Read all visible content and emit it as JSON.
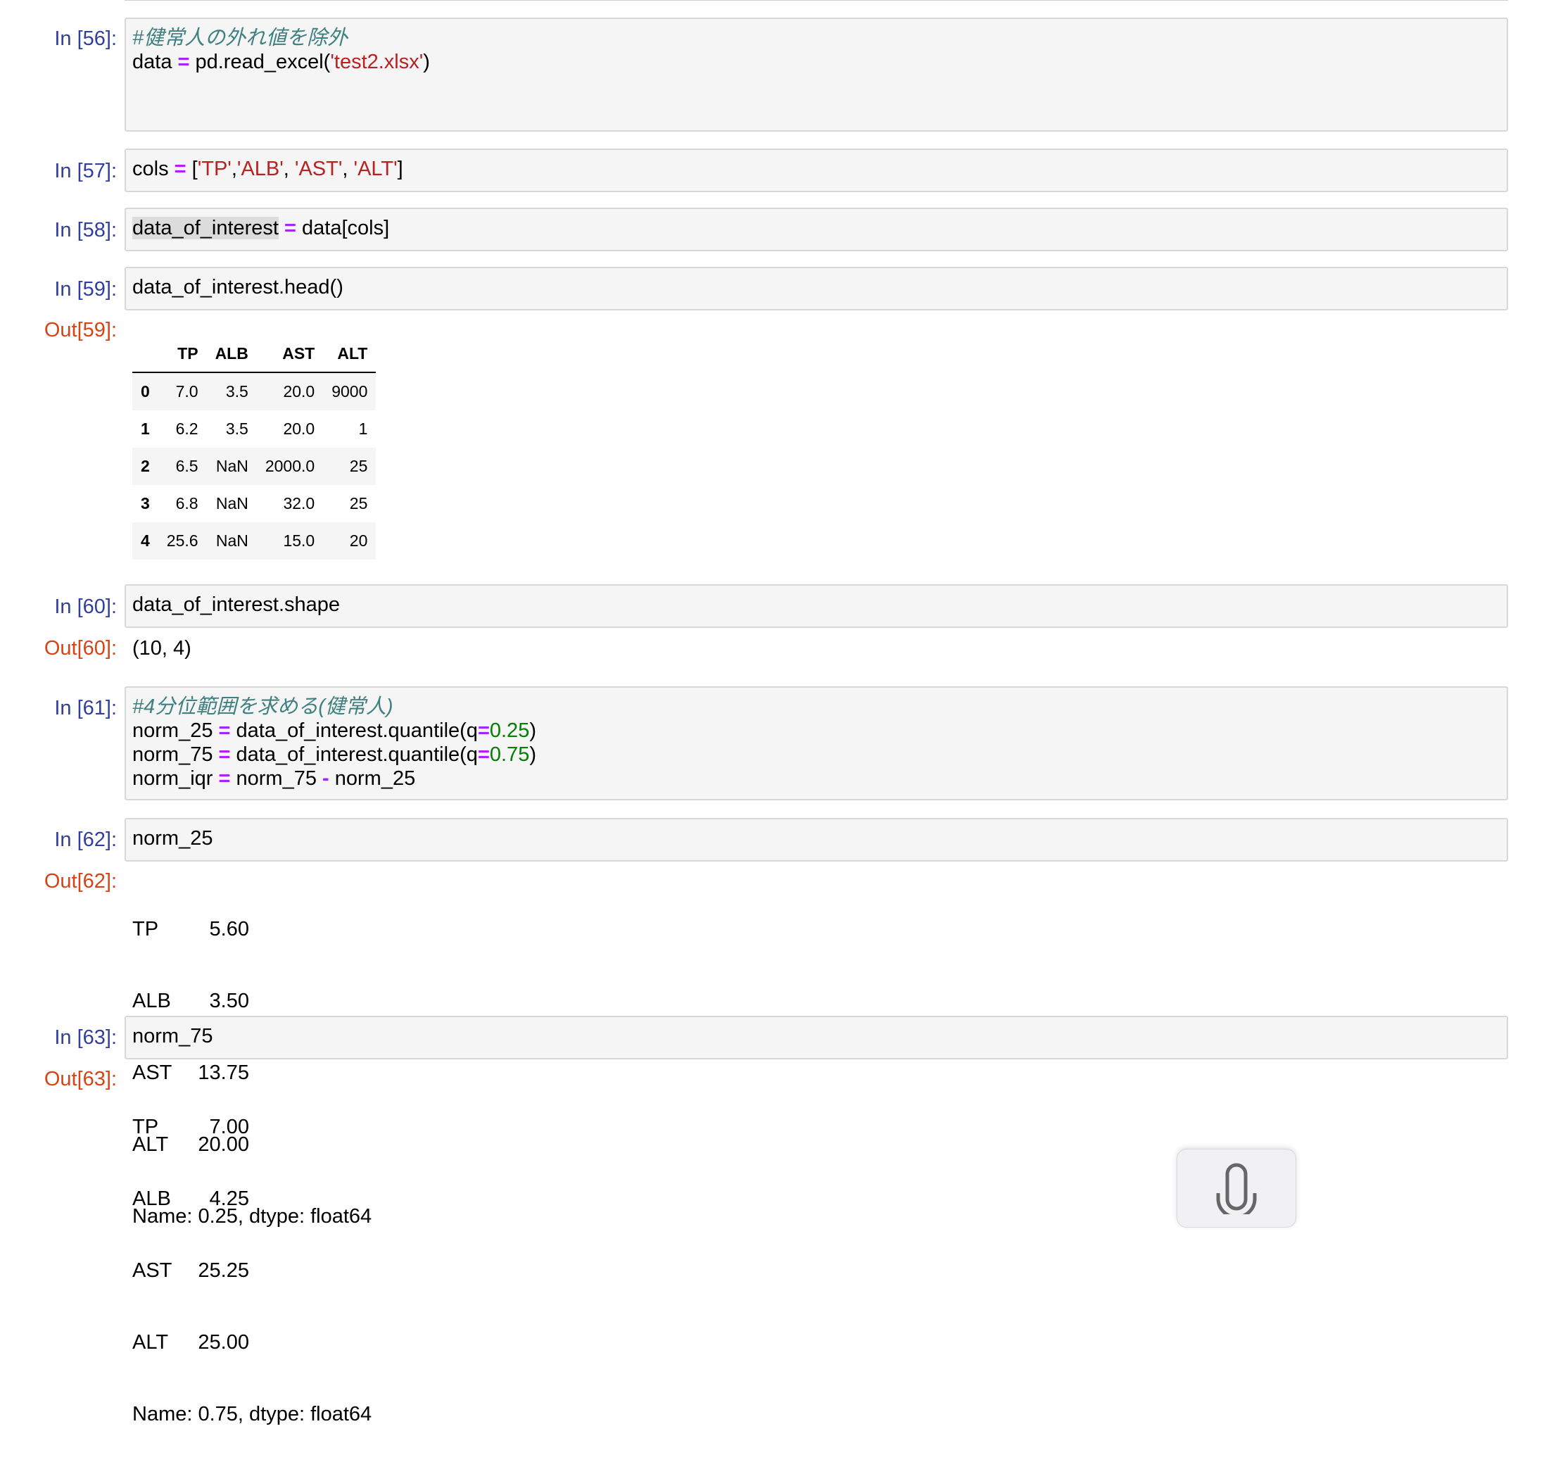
{
  "cells": {
    "c56": {
      "prompt": "In [56]:",
      "comment": "#健常人の外れ値を除外",
      "l2_a": "data ",
      "l2_eq": "=",
      "l2_b": " pd.read_excel(",
      "l2_str": "'test2.xlsx'",
      "l2_c": ")"
    },
    "c57": {
      "prompt": "In [57]:",
      "a": "cols ",
      "eq": "=",
      "b": " [",
      "s1": "'TP'",
      "comma1": ",",
      "s2": "'ALB'",
      "comma2": ", ",
      "s3": "'AST'",
      "comma3": ", ",
      "s4": "'ALT'",
      "c": "]"
    },
    "c58": {
      "prompt": "In [58]:",
      "hl": "data_of_interest",
      "a": " ",
      "eq": "=",
      "b": " data[cols]"
    },
    "c59": {
      "prompt": "In [59]:",
      "code": "data_of_interest.head()",
      "out_prompt": "Out[59]:",
      "table": {
        "columns": [
          "",
          "TP",
          "ALB",
          "AST",
          "ALT"
        ],
        "rows": [
          [
            "0",
            "7.0",
            "3.5",
            "20.0",
            "9000"
          ],
          [
            "1",
            "6.2",
            "3.5",
            "20.0",
            "1"
          ],
          [
            "2",
            "6.5",
            "NaN",
            "2000.0",
            "25"
          ],
          [
            "3",
            "6.8",
            "NaN",
            "32.0",
            "25"
          ],
          [
            "4",
            "25.6",
            "NaN",
            "15.0",
            "20"
          ]
        ]
      }
    },
    "c60": {
      "prompt": "In [60]:",
      "code": "data_of_interest.shape",
      "out_prompt": "Out[60]:",
      "output": "(10, 4)"
    },
    "c61": {
      "prompt": "In [61]:",
      "comment": "#4分位範囲を求める(健常人)",
      "l2_a": "norm_25 ",
      "l2_eq": "=",
      "l2_b": " data_of_interest.quantile(q",
      "l2_eq2": "=",
      "l2_num": "0.25",
      "l2_c": ")",
      "l3_a": "norm_75 ",
      "l3_eq": "=",
      "l3_b": " data_of_interest.quantile(q",
      "l3_eq2": "=",
      "l3_num": "0.75",
      "l3_c": ")",
      "l4_a": "norm_iqr ",
      "l4_eq": "=",
      "l4_b": " norm_75 ",
      "l4_op": "-",
      "l4_c": " norm_25"
    },
    "c62": {
      "prompt": "In [62]:",
      "code": "norm_25",
      "out_prompt": "Out[62]:",
      "series": [
        {
          "label": "TP",
          "value": "5.60"
        },
        {
          "label": "ALB",
          "value": "3.50"
        },
        {
          "label": "AST",
          "value": "13.75"
        },
        {
          "label": "ALT",
          "value": "20.00"
        }
      ],
      "footer": "Name: 0.25, dtype: float64"
    },
    "c63": {
      "prompt": "In [63]:",
      "code": "norm_75",
      "out_prompt": "Out[63]:",
      "series": [
        {
          "label": "TP",
          "value": "7.00"
        },
        {
          "label": "ALB",
          "value": "4.25"
        },
        {
          "label": "AST",
          "value": "25.25"
        },
        {
          "label": "ALT",
          "value": "25.00"
        }
      ],
      "footer": "Name: 0.75, dtype: float64"
    }
  },
  "icons": {
    "dictation": "microphone-icon"
  },
  "colors": {
    "in_prompt": "#303f9f",
    "out_prompt": "#d84315",
    "operator": "#aa22ff",
    "string": "#ba2121",
    "number": "#008000",
    "comment": "#408080",
    "cell_background": "#f5f5f5"
  }
}
